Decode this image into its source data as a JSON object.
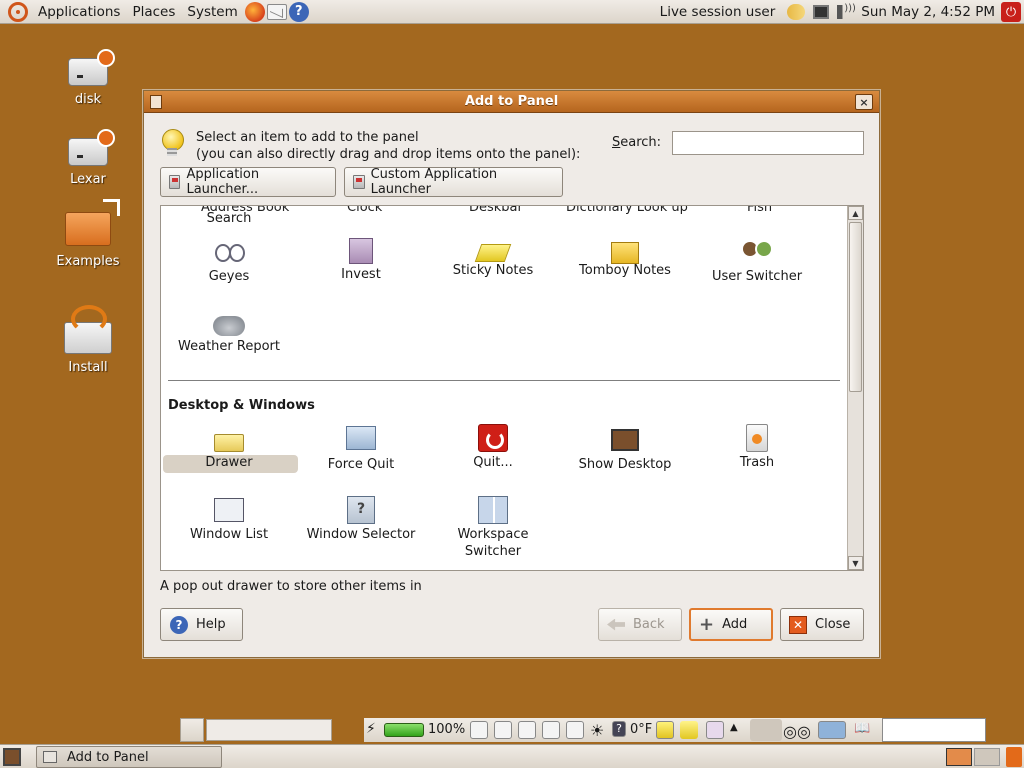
{
  "top_panel": {
    "menus": [
      "Applications",
      "Places",
      "System"
    ],
    "session_user": "Live session user",
    "clock": "Sun May  2,  4:52 PM"
  },
  "desktop": {
    "icons": [
      "disk",
      "Lexar",
      "Examples",
      "Install"
    ]
  },
  "dialog": {
    "title": "Add to Panel",
    "close_glyph": "×",
    "hint_line1": "Select an item to add to the panel",
    "hint_line2": "(you can also directly drag and drop items onto the panel):",
    "search_label_prefix": "",
    "search_label_key": "S",
    "search_label_rest": "earch:",
    "search_value": "",
    "app_launcher_label": "Application Launcher...",
    "custom_launcher_label": "Custom Application Launcher",
    "partial_items": [
      "Address Book",
      "Clock",
      "Deskbar",
      "Dictionary Look up",
      "Fish"
    ],
    "search_item_label": "Search",
    "row_items": [
      "Geyes",
      "Invest",
      "Sticky Notes",
      "Tomboy Notes",
      "User Switcher"
    ],
    "weather_label": "Weather Report",
    "section_title": "Desktop & Windows",
    "desktop_items": [
      "Drawer",
      "Force Quit",
      "Quit...",
      "Show Desktop",
      "Trash"
    ],
    "desktop_items2": [
      "Window List",
      "Window Selector",
      "Workspace",
      "Switcher"
    ],
    "description": "A pop out drawer to store other items in",
    "help_label": "Help",
    "back_label": "Back",
    "add_label": "Add",
    "close_label": "Close"
  },
  "bottom_applets": {
    "battery_percent": "100%",
    "temperature": "0°F"
  },
  "bottom_panel": {
    "task_label": "Add to Panel"
  }
}
